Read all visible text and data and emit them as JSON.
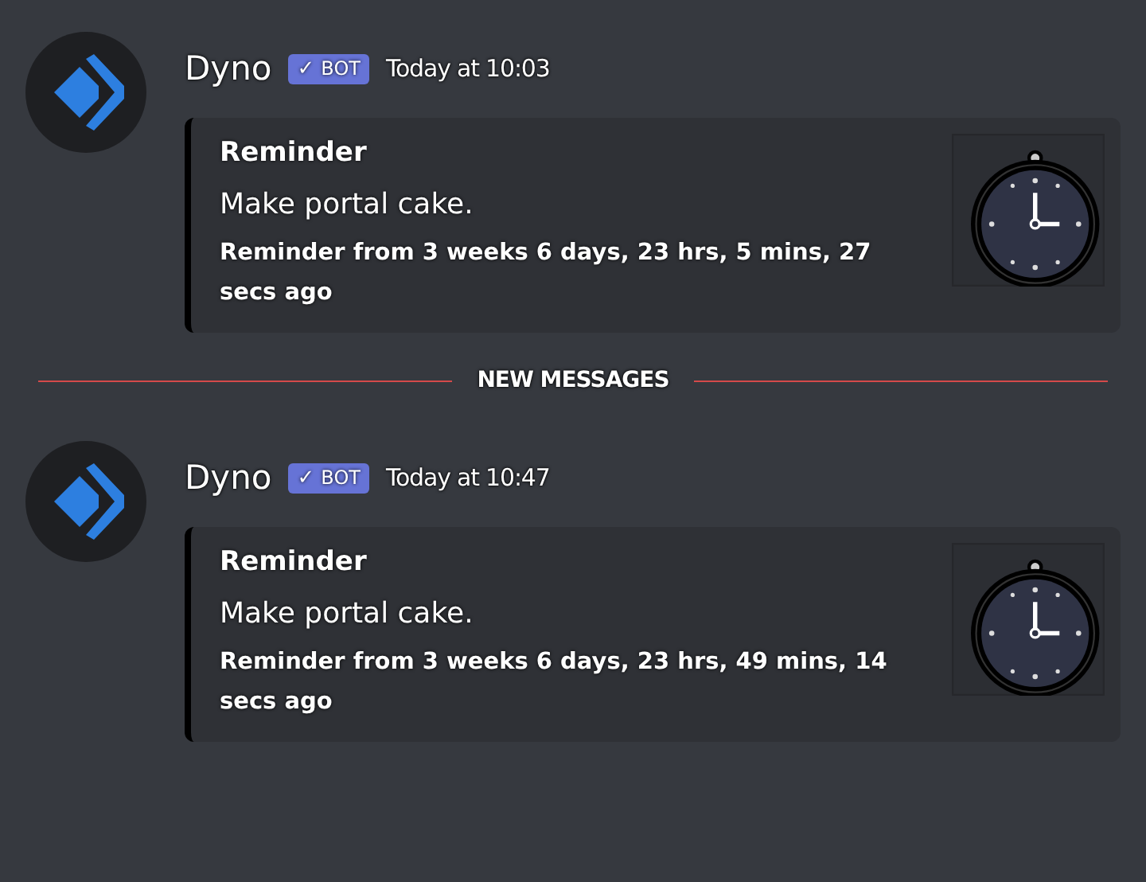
{
  "feed": [
    {
      "kind": "message",
      "author": "Dyno",
      "tag": "BOT",
      "tag_icon": "✓",
      "timestamp": "Today at 10:03",
      "embed": {
        "title": "Reminder",
        "description": "Make portal cake.",
        "footer": "Reminder from 3 weeks 6 days, 23 hrs, 5 mins, 27 secs ago"
      }
    },
    {
      "kind": "divider",
      "label": "NEW MESSAGES"
    },
    {
      "kind": "message",
      "author": "Dyno",
      "tag": "BOT",
      "tag_icon": "✓",
      "timestamp": "Today at 10:47",
      "embed": {
        "title": "Reminder",
        "description": "Make portal cake.",
        "footer": "Reminder from 3 weeks 6 days, 23 hrs, 49 mins, 14 secs ago"
      }
    }
  ]
}
